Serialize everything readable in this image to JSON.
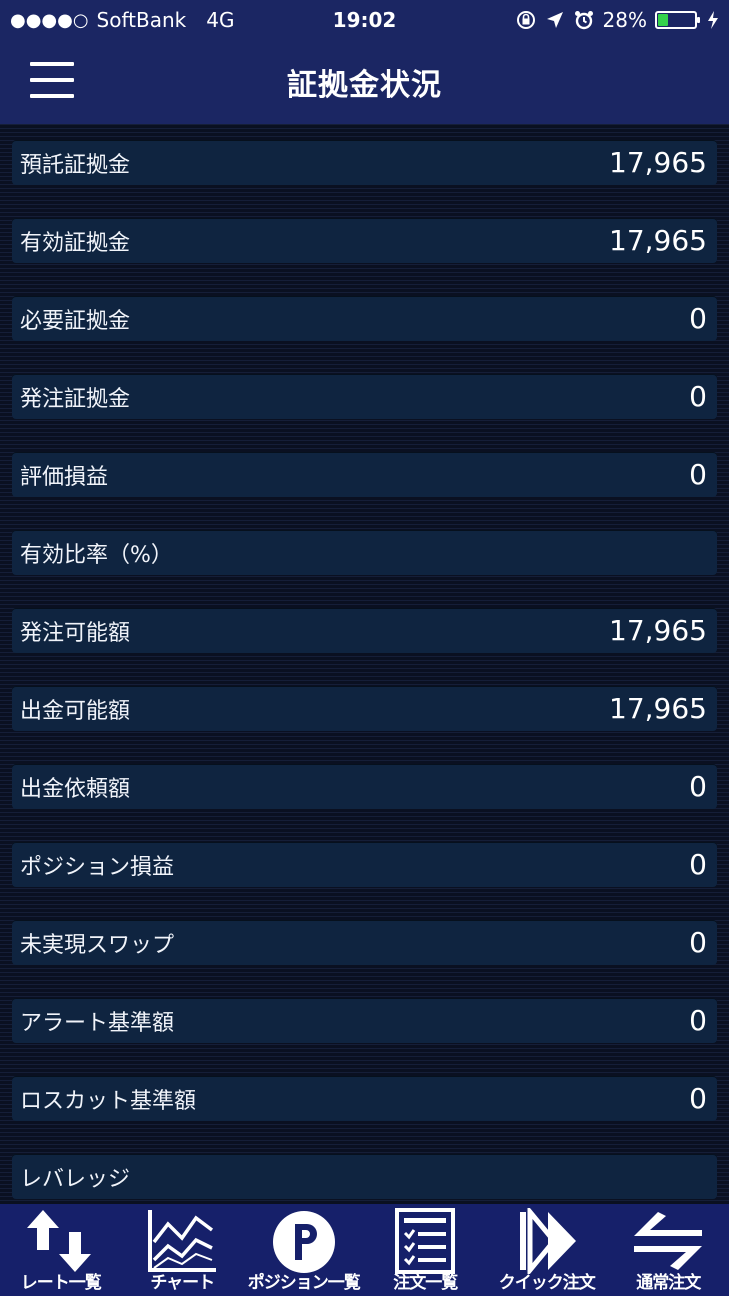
{
  "status_bar": {
    "signal": "●●●●○",
    "carrier": "SoftBank",
    "network": "4G",
    "time": "19:02",
    "battery_percent": "28%",
    "battery_level": 0.28,
    "icons": [
      "rotation-lock-icon",
      "location-arrow-icon",
      "alarm-icon",
      "battery-icon",
      "charging-bolt-icon"
    ]
  },
  "header": {
    "title": "証拠金状況",
    "menu_icon": "hamburger-menu-icon"
  },
  "rows": [
    {
      "label": "預託証拠金",
      "value": "17,965"
    },
    {
      "label": "有効証拠金",
      "value": "17,965"
    },
    {
      "label": "必要証拠金",
      "value": "0"
    },
    {
      "label": "発注証拠金",
      "value": "0"
    },
    {
      "label": "評価損益",
      "value": "0"
    },
    {
      "label": "有効比率（%）",
      "value": ""
    },
    {
      "label": "発注可能額",
      "value": "17,965"
    },
    {
      "label": "出金可能額",
      "value": "17,965"
    },
    {
      "label": "出金依頼額",
      "value": "0"
    },
    {
      "label": "ポジション損益",
      "value": "0"
    },
    {
      "label": "未実現スワップ",
      "value": "0"
    },
    {
      "label": "アラート基準額",
      "value": "0"
    },
    {
      "label": "ロスカット基準額",
      "value": "0"
    },
    {
      "label": "レバレッジ",
      "value": ""
    }
  ],
  "tabbar": {
    "tabs": [
      {
        "label": "レート一覧",
        "icon": "up-down-arrows-icon"
      },
      {
        "label": "チャート",
        "icon": "chart-icon"
      },
      {
        "label": "ポジション一覧",
        "icon": "position-p-icon"
      },
      {
        "label": "注文一覧",
        "icon": "order-list-icon"
      },
      {
        "label": "クイック注文",
        "icon": "quick-forward-icon"
      },
      {
        "label": "通常注文",
        "icon": "exchange-arrows-icon"
      }
    ]
  },
  "colors": {
    "header_bg": "#1b2663",
    "tabbar_bg": "#16206a",
    "row_bg": "#0f2440",
    "battery_fill": "#34d24a"
  }
}
